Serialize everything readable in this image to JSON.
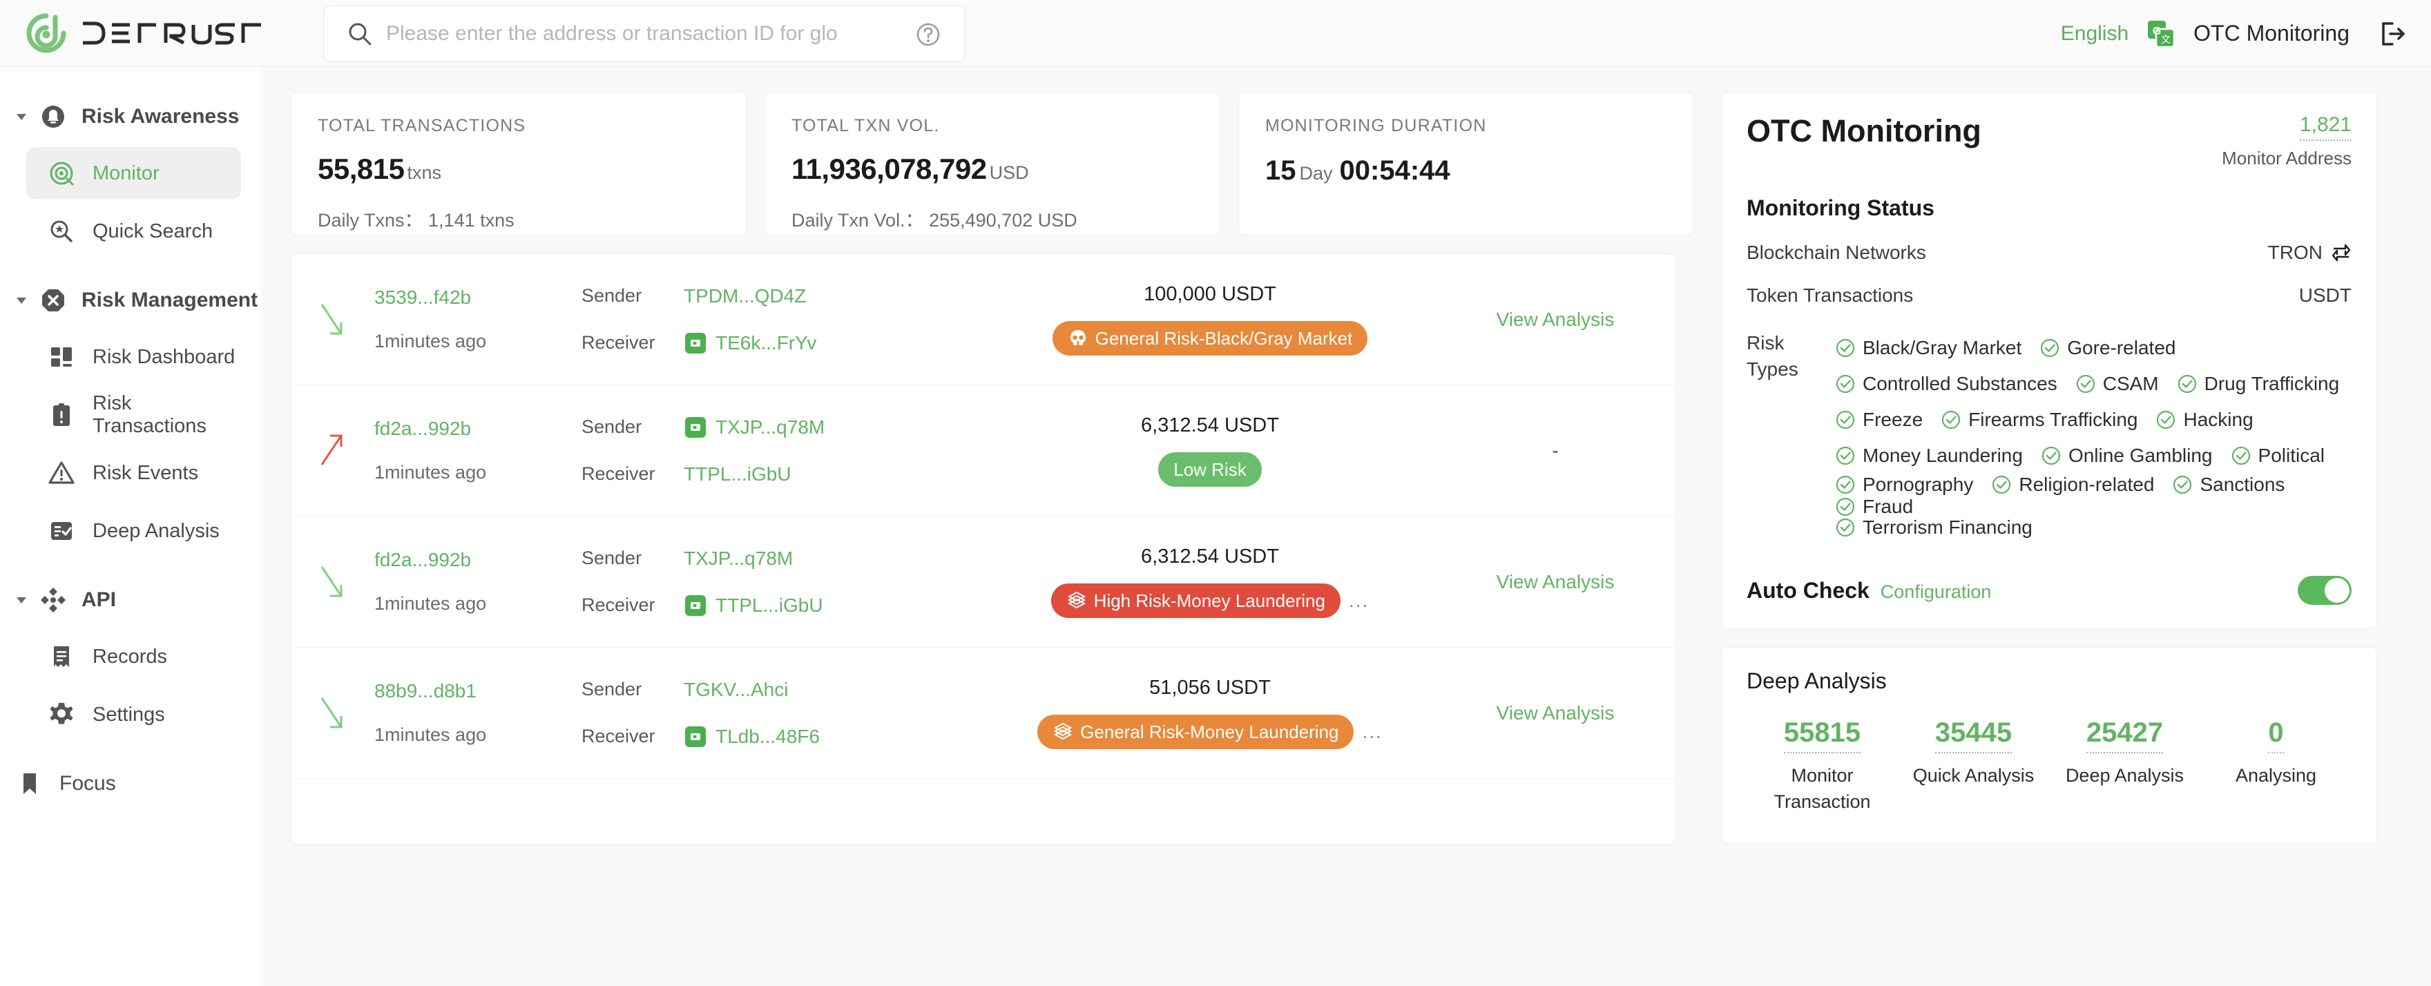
{
  "header": {
    "logo_text": "DETRUST",
    "search": {
      "placeholder": "Please enter the address or transaction ID for glo",
      "value": ""
    },
    "language": "English",
    "account": "OTC Monitoring"
  },
  "sidebar": {
    "groups": [
      {
        "label": "Risk Awareness",
        "icon": "bell-icon",
        "items": [
          {
            "label": "Monitor",
            "icon": "target-icon",
            "active": true
          },
          {
            "label": "Quick Search",
            "icon": "search-star-icon",
            "active": false
          }
        ]
      },
      {
        "label": "Risk Management",
        "icon": "octagon-x-icon",
        "items": [
          {
            "label": "Risk Dashboard",
            "icon": "dashboard-icon",
            "active": false
          },
          {
            "label": "Risk Transactions",
            "icon": "clipboard-alert-icon",
            "active": false
          },
          {
            "label": "Risk Events",
            "icon": "warning-triangle-icon",
            "active": false
          },
          {
            "label": "Deep Analysis",
            "icon": "checklist-icon",
            "active": false
          }
        ]
      },
      {
        "label": "API",
        "icon": "api-diamond-icon",
        "items": [
          {
            "label": "Records",
            "icon": "receipt-icon",
            "active": false
          },
          {
            "label": "Settings",
            "icon": "gear-icon",
            "active": false
          }
        ]
      }
    ],
    "focus": {
      "label": "Focus",
      "icon": "bookmark-icon"
    }
  },
  "stats": [
    {
      "title": "TOTAL TRANSACTIONS",
      "value": "55,815",
      "unit": "txns",
      "sub": "Daily Txns： 1,141 txns"
    },
    {
      "title": "TOTAL TXN VOL.",
      "value": "11,936,078,792",
      "unit": "USD",
      "sub": "Daily Txn Vol.： 255,490,702 USD"
    },
    {
      "title": "MONITORING DURATION",
      "days": "15",
      "day_label": "Day",
      "clock": "00:54:44"
    }
  ],
  "transactions": {
    "sender_label": "Sender",
    "receiver_label": "Receiver",
    "view_label": "View Analysis",
    "none_label": "-",
    "more_label": "...",
    "rows": [
      {
        "direction": "in",
        "hash": "3539...f42b",
        "time": "1minutes ago",
        "sender": "TPDM...QD4Z",
        "sender_badge": false,
        "receiver": "TE6k...FrYv",
        "receiver_badge": true,
        "amount": "100,000 USDT",
        "tag": "General Risk-Black/Gray Market",
        "tag_color": "#e8883a",
        "tag_icon": "skull-icon",
        "tag_more": false,
        "action": "view"
      },
      {
        "direction": "out",
        "hash": "fd2a...992b",
        "time": "1minutes ago",
        "sender": "TXJP...q78M",
        "sender_badge": true,
        "receiver": "TTPL...iGbU",
        "receiver_badge": false,
        "amount": "6,312.54 USDT",
        "tag": "Low Risk",
        "tag_color": "#6abd6a",
        "tag_icon": "",
        "tag_more": false,
        "action": "none"
      },
      {
        "direction": "in",
        "hash": "fd2a...992b",
        "time": "1minutes ago",
        "sender": "TXJP...q78M",
        "sender_badge": false,
        "receiver": "TTPL...iGbU",
        "receiver_badge": true,
        "amount": "6,312.54 USDT",
        "tag": "High Risk-Money Laundering",
        "tag_color": "#e04b3c",
        "tag_icon": "money-stack-icon",
        "tag_more": true,
        "action": "view"
      },
      {
        "direction": "in",
        "hash": "88b9...d8b1",
        "time": "1minutes ago",
        "sender": "TGKV...Ahci",
        "sender_badge": false,
        "receiver": "TLdb...48F6",
        "receiver_badge": true,
        "amount": "51,056 USDT",
        "tag": "General Risk-Money Laundering",
        "tag_color": "#e8883a",
        "tag_icon": "money-stack-icon",
        "tag_more": true,
        "action": "view"
      }
    ]
  },
  "otc": {
    "title": "OTC Monitoring",
    "monitor_address_count": "1,821",
    "monitor_address_label": "Monitor Address",
    "monitoring_status_title": "Monitoring Status",
    "blockchain_label": "Blockchain Networks",
    "blockchain_value": "TRON",
    "token_label": "Token Transactions",
    "token_value": "USDT",
    "risk_types_label_line1": "Risk",
    "risk_types_label_line2": "Types",
    "risk_types": [
      [
        "Black/Gray Market",
        "Gore-related"
      ],
      [
        "Controlled Substances",
        "CSAM",
        "Drug Trafficking"
      ],
      [
        "Freeze",
        "Firearms Trafficking",
        "Hacking"
      ],
      [
        "Money Laundering",
        "Online Gambling",
        "Political"
      ],
      [
        "Pornography",
        "Religion-related",
        "Sanctions",
        "Fraud"
      ],
      [
        "Terrorism Financing"
      ]
    ],
    "auto_check_title": "Auto Check",
    "auto_check_config": "Configuration",
    "auto_check_enabled": true
  },
  "deep_analysis": {
    "title": "Deep Analysis",
    "stats": [
      {
        "value": "55815",
        "label": "Monitor Transaction"
      },
      {
        "value": "35445",
        "label": "Quick Analysis"
      },
      {
        "value": "25427",
        "label": "Deep Analysis"
      },
      {
        "value": "0",
        "label": "Analysing"
      }
    ]
  },
  "colors": {
    "brand_green": "#63b363",
    "high_risk_red": "#e04b3c",
    "general_risk_orange": "#e8883a",
    "low_risk_green": "#6abd6a"
  }
}
